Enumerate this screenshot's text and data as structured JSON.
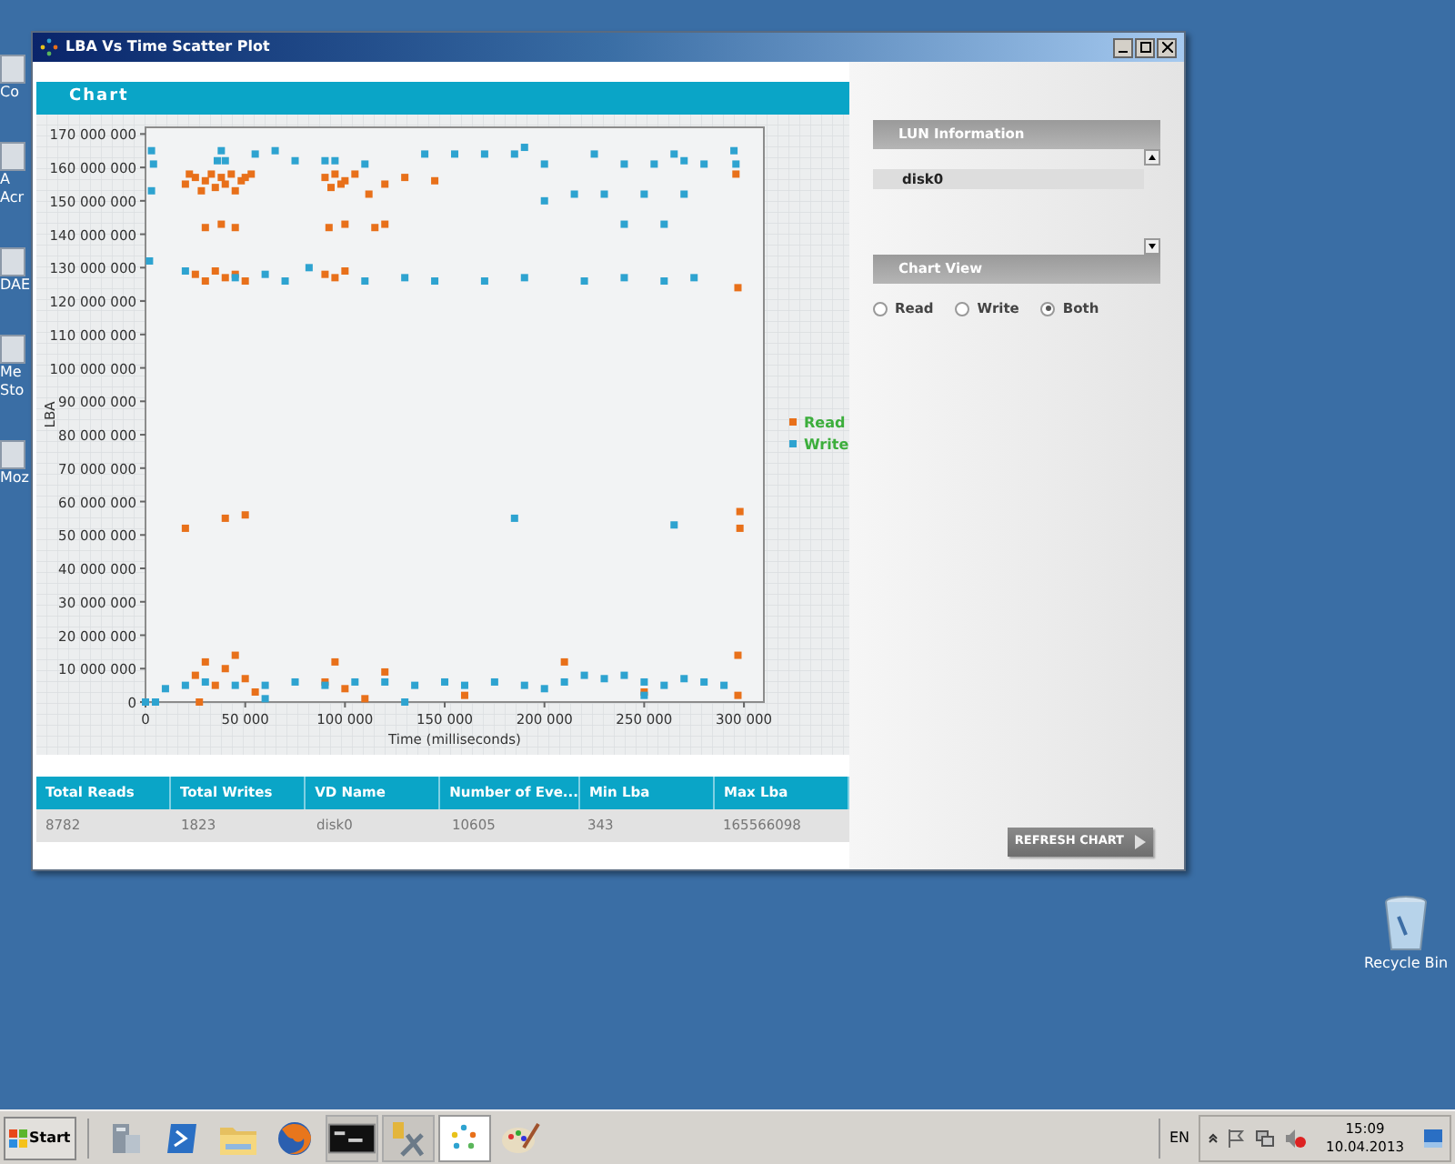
{
  "desktop_icons": [
    {
      "label": "Co"
    },
    {
      "label": "A\nAcr"
    },
    {
      "label": "DAE"
    },
    {
      "label": "Me\nSto"
    },
    {
      "label": "Moz"
    }
  ],
  "recycle_bin": {
    "label": "Recycle Bin"
  },
  "window": {
    "title": "LBA Vs Time Scatter Plot"
  },
  "chart_panel": {
    "title": "Chart",
    "chart_data": {
      "type": "scatter",
      "legend": "right",
      "xlabel": "Time (milliseconds)",
      "ylabel": "LBA",
      "xlim": [
        0,
        310000
      ],
      "ylim": [
        0,
        172000000
      ],
      "xticks": [
        0,
        {
          "value": 50000,
          "label": "50 000"
        },
        {
          "value": 100000,
          "label": "100 000"
        },
        {
          "value": 150000,
          "label": "150 000"
        },
        {
          "value": 200000,
          "label": "200 000"
        },
        {
          "value": 250000,
          "label": "250 000"
        },
        {
          "value": 300000,
          "label": "300 000"
        }
      ],
      "yticks": [
        0,
        {
          "value": 10000000,
          "label": "10 000 000"
        },
        {
          "value": 20000000,
          "label": "20 000 000"
        },
        {
          "value": 30000000,
          "label": "30 000 000"
        },
        {
          "value": 40000000,
          "label": "40 000 000"
        },
        {
          "value": 50000000,
          "label": "50 000 000"
        },
        {
          "value": 60000000,
          "label": "60 000 000"
        },
        {
          "value": 70000000,
          "label": "70 000 000"
        },
        {
          "value": 80000000,
          "label": "80 000 000"
        },
        {
          "value": 90000000,
          "label": "90 000 000"
        },
        {
          "value": 100000000,
          "label": "100 000 000"
        },
        {
          "value": 110000000,
          "label": "110 000 000"
        },
        {
          "value": 120000000,
          "label": "120 000 000"
        },
        {
          "value": 130000000,
          "label": "130 000 000"
        },
        {
          "value": 140000000,
          "label": "140 000 000"
        },
        {
          "value": 150000000,
          "label": "150 000 000"
        },
        {
          "value": 160000000,
          "label": "160 000 000"
        },
        {
          "value": 170000000,
          "label": "170 000 000"
        }
      ],
      "series": [
        {
          "name": "Read",
          "color": "#e8701a",
          "x": [
            20000,
            22000,
            25000,
            28000,
            30000,
            33000,
            35000,
            38000,
            40000,
            43000,
            45000,
            48000,
            50000,
            53000,
            25000,
            30000,
            35000,
            40000,
            45000,
            50000,
            30000,
            38000,
            45000,
            90000,
            93000,
            95000,
            98000,
            100000,
            105000,
            112000,
            120000,
            130000,
            145000,
            90000,
            95000,
            100000,
            92000,
            100000,
            115000,
            120000,
            20000,
            40000,
            50000,
            298000,
            298000,
            297000,
            296000,
            25000,
            30000,
            35000,
            40000,
            45000,
            50000,
            55000,
            90000,
            95000,
            100000,
            120000,
            160000,
            210000,
            250000,
            297000,
            297000,
            27000,
            110000
          ],
          "values": [
            155000000,
            158000000,
            157000000,
            153000000,
            156000000,
            158000000,
            154000000,
            157000000,
            155000000,
            158000000,
            153000000,
            156000000,
            157000000,
            158000000,
            128000000,
            126000000,
            129000000,
            127000000,
            128000000,
            126000000,
            142000000,
            143000000,
            142000000,
            157000000,
            154000000,
            158000000,
            155000000,
            156000000,
            158000000,
            152000000,
            155000000,
            157000000,
            156000000,
            128000000,
            127000000,
            129000000,
            142000000,
            143000000,
            142000000,
            143000000,
            52000000,
            55000000,
            56000000,
            57000000,
            52000000,
            124000000,
            158000000,
            8000000,
            12000000,
            5000000,
            10000000,
            14000000,
            7000000,
            3000000,
            6000000,
            12000000,
            4000000,
            9000000,
            2000000,
            12000000,
            3000000,
            14000000,
            2000000,
            0,
            1000000
          ]
        },
        {
          "name": "Write",
          "color": "#2ea3d0",
          "x": [
            3000,
            4000,
            3000,
            38000,
            36000,
            40000,
            55000,
            65000,
            75000,
            90000,
            95000,
            110000,
            140000,
            155000,
            170000,
            185000,
            190000,
            200000,
            225000,
            240000,
            255000,
            265000,
            270000,
            280000,
            295000,
            296000,
            200000,
            215000,
            230000,
            250000,
            270000,
            260000,
            240000,
            2000,
            20000,
            45000,
            60000,
            70000,
            82000,
            110000,
            130000,
            145000,
            170000,
            190000,
            220000,
            240000,
            260000,
            275000,
            10000,
            20000,
            30000,
            45000,
            60000,
            75000,
            90000,
            105000,
            120000,
            135000,
            150000,
            160000,
            175000,
            190000,
            200000,
            210000,
            220000,
            230000,
            240000,
            250000,
            260000,
            270000,
            280000,
            290000,
            185000,
            265000,
            0,
            5000,
            60000,
            130000,
            250000
          ],
          "values": [
            165000000,
            161000000,
            153000000,
            165000000,
            162000000,
            162000000,
            164000000,
            165000000,
            162000000,
            162000000,
            162000000,
            161000000,
            164000000,
            164000000,
            164000000,
            164000000,
            166000000,
            161000000,
            164000000,
            161000000,
            161000000,
            164000000,
            162000000,
            161000000,
            165000000,
            161000000,
            150000000,
            152000000,
            152000000,
            152000000,
            152000000,
            143000000,
            143000000,
            132000000,
            129000000,
            127000000,
            128000000,
            126000000,
            130000000,
            126000000,
            127000000,
            126000000,
            126000000,
            127000000,
            126000000,
            127000000,
            126000000,
            127000000,
            4000000,
            5000000,
            6000000,
            5000000,
            5000000,
            6000000,
            5000000,
            6000000,
            6000000,
            5000000,
            6000000,
            5000000,
            6000000,
            5000000,
            4000000,
            6000000,
            8000000,
            7000000,
            8000000,
            6000000,
            5000000,
            7000000,
            6000000,
            5000000,
            55000000,
            53000000,
            0,
            0,
            1000000,
            0,
            2000000
          ]
        }
      ]
    }
  },
  "stats_table": {
    "columns": [
      "Total Reads",
      "Total Writes",
      "VD Name",
      "Number of Eve...",
      "Min Lba",
      "Max Lba"
    ],
    "rows": [
      [
        "8782",
        "1823",
        "disk0",
        "10605",
        "343",
        "165566098"
      ]
    ]
  },
  "lun_information": {
    "title": "LUN Information",
    "items": [
      {
        "label": "disk0",
        "selected": true
      }
    ]
  },
  "chart_view": {
    "title": "Chart View",
    "options": [
      {
        "label": "Read",
        "selected": false
      },
      {
        "label": "Write",
        "selected": false
      },
      {
        "label": "Both",
        "selected": true
      }
    ]
  },
  "refresh_button": {
    "label": "REFRESH CHART"
  },
  "taskbar": {
    "start": "Start",
    "items": [
      {
        "kind": "server",
        "selected": false
      },
      {
        "kind": "shell",
        "selected": false
      },
      {
        "kind": "folder",
        "selected": false
      },
      {
        "kind": "browser",
        "selected": false
      },
      {
        "kind": "console",
        "selected": false
      },
      {
        "kind": "tools",
        "selected": false
      },
      {
        "kind": "app",
        "selected": true
      },
      {
        "kind": "paint",
        "selected": false
      }
    ],
    "language": "EN",
    "time": "15:09",
    "date": "10.04.2013"
  }
}
